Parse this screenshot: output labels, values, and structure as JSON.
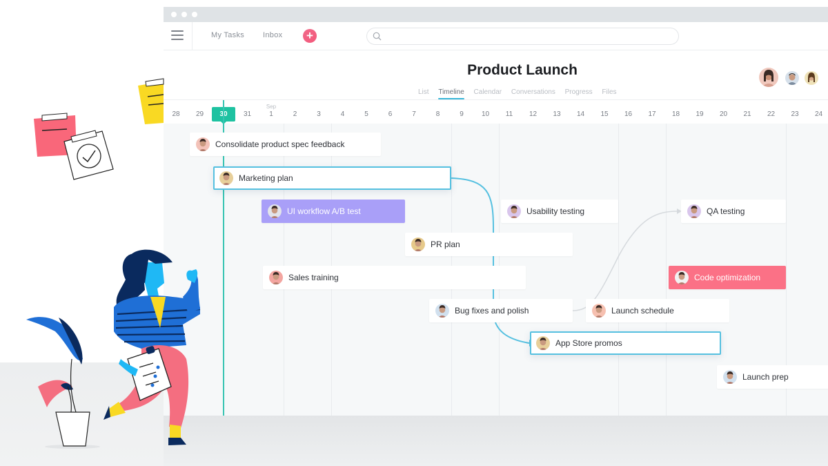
{
  "window": {
    "controls": [
      "close",
      "minimize",
      "maximize"
    ]
  },
  "topbar": {
    "menu_icon": "hamburger-icon",
    "nav": [
      {
        "label": "My Tasks"
      },
      {
        "label": "Inbox"
      }
    ],
    "add_icon": "plus-icon",
    "search": {
      "placeholder": "",
      "value": "",
      "icon": "search-icon"
    }
  },
  "project": {
    "title": "Product Launch",
    "tabs": [
      {
        "label": "List",
        "active": false
      },
      {
        "label": "Timeline",
        "active": true
      },
      {
        "label": "Calendar",
        "active": false
      },
      {
        "label": "Conversations",
        "active": false
      },
      {
        "label": "Progress",
        "active": false
      },
      {
        "label": "Files",
        "active": false
      }
    ],
    "members": [
      {
        "name": "member-1",
        "color": "#e8b4a8"
      },
      {
        "name": "member-2",
        "color": "#c9d6e3"
      },
      {
        "name": "member-3",
        "color": "#e9d9a8"
      }
    ]
  },
  "timeline": {
    "month_label": "Sep",
    "today": "30",
    "dates": [
      "28",
      "29",
      "30",
      "31",
      "1",
      "2",
      "3",
      "4",
      "5",
      "6",
      "7",
      "8",
      "9",
      "10",
      "11",
      "12",
      "13",
      "14",
      "15",
      "16",
      "17",
      "18",
      "19",
      "20",
      "21",
      "22",
      "23",
      "24"
    ],
    "tasks": [
      {
        "name": "Consolidate product spec feedback",
        "style": "normal",
        "avatar": "#f3c2b8"
      },
      {
        "name": "Marketing plan",
        "style": "selected",
        "avatar": "#e7cf9a"
      },
      {
        "name": "UI workflow A/B test",
        "style": "purple",
        "avatar": "#e2e4ea"
      },
      {
        "name": "Usability testing",
        "style": "normal",
        "avatar": "#d9c6ec"
      },
      {
        "name": "QA testing",
        "style": "normal",
        "avatar": "#d9c6ec"
      },
      {
        "name": "PR plan",
        "style": "normal",
        "avatar": "#e6c98a"
      },
      {
        "name": "Sales training",
        "style": "normal",
        "avatar": "#f3a5a0"
      },
      {
        "name": "Code optimization",
        "style": "red",
        "avatar": "#f2f2f2"
      },
      {
        "name": "Bug fixes and polish",
        "style": "normal",
        "avatar": "#d1e0ee"
      },
      {
        "name": "Launch schedule",
        "style": "normal",
        "avatar": "#f6c0b0"
      },
      {
        "name": "App Store promos",
        "style": "selected",
        "avatar": "#e7cf9a"
      },
      {
        "name": "Launch prep",
        "style": "normal",
        "avatar": "#d1e0ee"
      }
    ],
    "colors": {
      "today": "#1ec2a1",
      "selected_border": "#55c0e0",
      "purple_task": "#a99ff8",
      "red_task": "#fb7186",
      "dependency_active": "#55c0e0",
      "dependency_inactive": "#d5d9dd"
    }
  }
}
